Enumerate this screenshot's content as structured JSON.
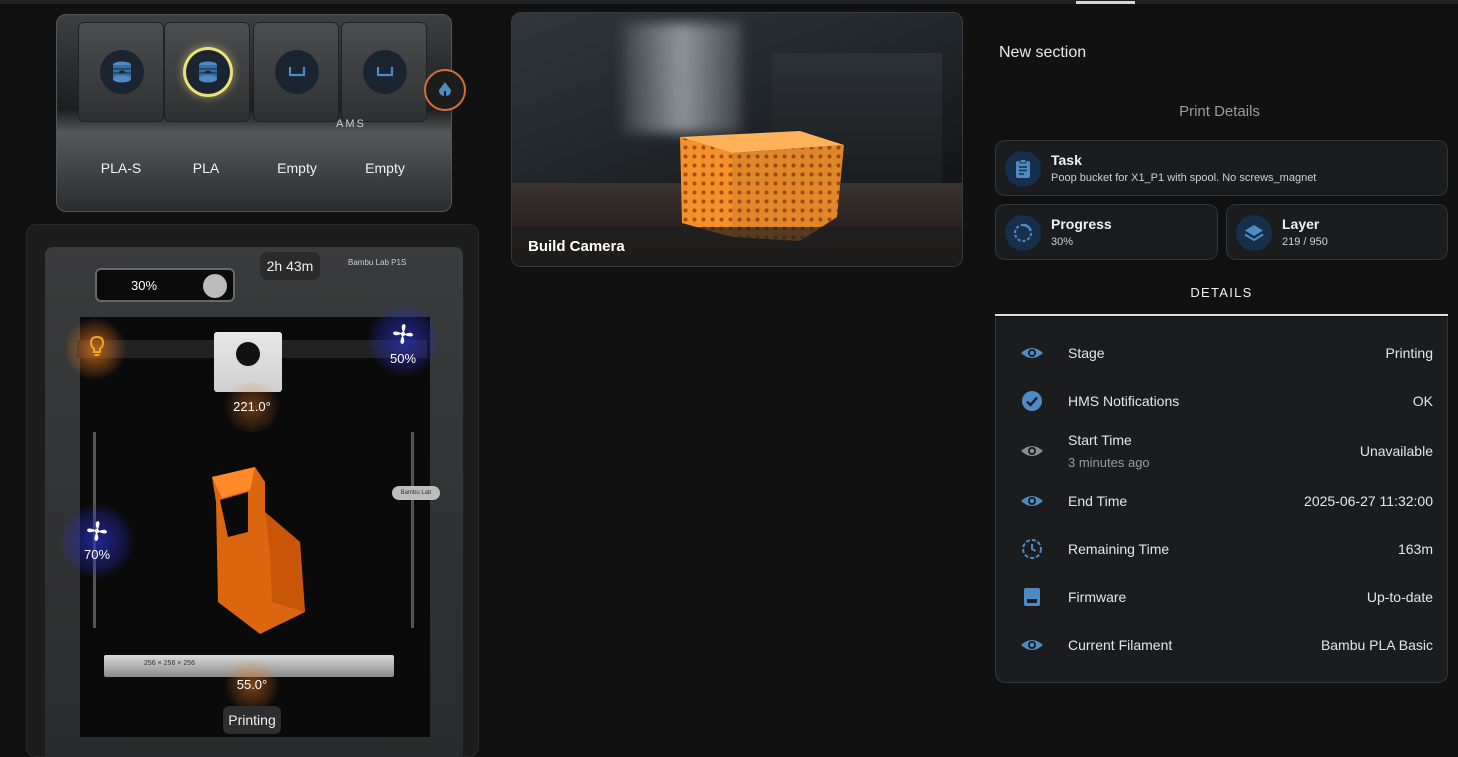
{
  "colors": {
    "accent_blue": "#4e8bc4",
    "fan_glow": "#2830be",
    "heat_glow": "#e6781e",
    "filament_orange": "#e86a10",
    "active_slot": "#ece07a"
  },
  "ams": {
    "slots": [
      {
        "label": "PLA-S",
        "icon": "spool-icon",
        "active": false
      },
      {
        "label": "PLA",
        "icon": "spool-icon",
        "active": true
      },
      {
        "label": "Empty",
        "icon": "empty-tray-icon",
        "active": false
      },
      {
        "label": "Empty",
        "icon": "empty-tray-icon",
        "active": false
      }
    ],
    "brand": "AMS",
    "dry_icon": "humidity-drop-icon"
  },
  "printer": {
    "screen_progress": "30%",
    "remaining": "2h 43m",
    "brand": "Bambu Lab P1S",
    "aux_fan": "50%",
    "part_fan": "70%",
    "nozzle_temp": "221.0°",
    "bed_temp": "55.0°",
    "status": "Printing",
    "side_tag": "Bambu Lab",
    "plate_text": "256 × 256 × 256"
  },
  "camera": {
    "label": "Build Camera"
  },
  "section": {
    "title": "New section",
    "print_details": "Print Details"
  },
  "task": {
    "title": "Task",
    "value": "Poop bucket for X1_P1 with spool. No screws_magnet",
    "icon": "clipboard-icon"
  },
  "progress": {
    "title": "Progress",
    "value": "30%",
    "fraction": 0.3,
    "icon": "progress-ring-icon"
  },
  "layer": {
    "title": "Layer",
    "value": "219 / 950",
    "icon": "layers-icon"
  },
  "details": {
    "tab_label": "DETAILS",
    "rows": [
      {
        "label": "Stage",
        "sub": "",
        "value": "Printing",
        "icon": "eye-icon"
      },
      {
        "label": "HMS Notifications",
        "sub": "",
        "value": "OK",
        "icon": "check-circle-icon"
      },
      {
        "label": "Start Time",
        "sub": "3 minutes ago",
        "value": "Unavailable",
        "icon": "eye-icon"
      },
      {
        "label": "End Time",
        "sub": "",
        "value": "2025-06-27 11:32:00",
        "icon": "eye-icon"
      },
      {
        "label": "Remaining Time",
        "sub": "",
        "value": "163m",
        "icon": "timer-icon"
      },
      {
        "label": "Firmware",
        "sub": "",
        "value": "Up-to-date",
        "icon": "firmware-icon"
      },
      {
        "label": "Current Filament",
        "sub": "",
        "value": "Bambu PLA Basic",
        "icon": "eye-icon"
      }
    ]
  }
}
